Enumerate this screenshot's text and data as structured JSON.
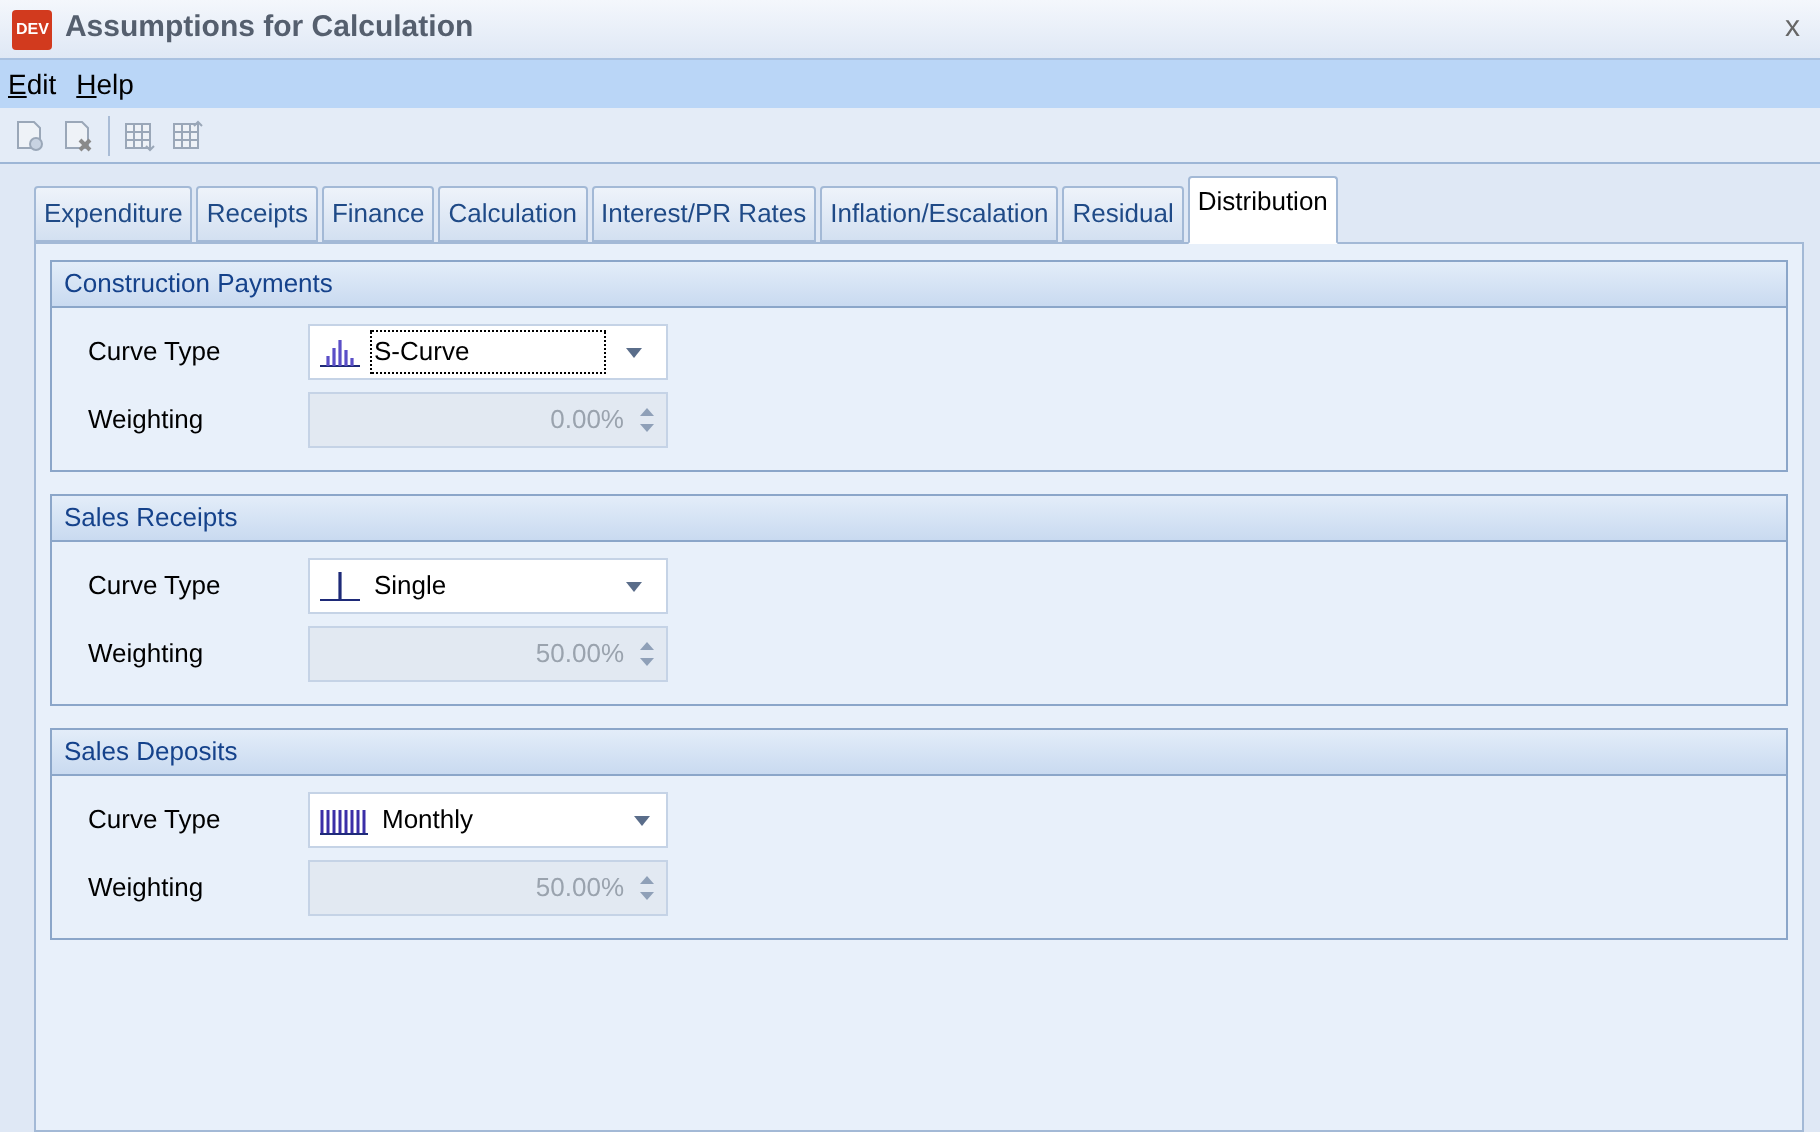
{
  "window": {
    "logo": "DEV",
    "title": "Assumptions for Calculation",
    "close": "x"
  },
  "menu": [
    "Edit",
    "Help"
  ],
  "toolbar": [
    {
      "kind": "page_add",
      "disabled": true
    },
    {
      "kind": "page_delete",
      "disabled": true
    },
    {
      "kind": "grid_down",
      "disabled": true
    },
    {
      "kind": "grid_up",
      "disabled": true
    }
  ],
  "tabs": [
    {
      "label": "Expenditure",
      "selected": false
    },
    {
      "label": "Receipts",
      "selected": false
    },
    {
      "label": "Finance",
      "selected": false
    },
    {
      "label": "Calculation",
      "selected": false
    },
    {
      "label": "Interest/PR Rates",
      "selected": false
    },
    {
      "label": "Inflation/Escalation",
      "selected": false
    },
    {
      "label": "Residual",
      "selected": false
    },
    {
      "label": "Distribution",
      "selected": true
    }
  ],
  "groups": [
    {
      "title": "Construction Payments",
      "curve_label": "Curve Type",
      "curve": {
        "kind": "s_curve",
        "value": "S-Curve",
        "focused": true
      },
      "weighting_label": "Weighting",
      "weighting": {
        "value": "0.00%",
        "disabled": true
      }
    },
    {
      "title": "Sales Receipts",
      "curve_label": "Curve Type",
      "curve": {
        "kind": "single",
        "value": "Single",
        "focused": false
      },
      "weighting_label": "Weighting",
      "weighting": {
        "value": "50.00%",
        "disabled": true
      }
    },
    {
      "title": "Sales Deposits",
      "curve_label": "Curve Type",
      "curve": {
        "kind": "monthly",
        "value": "Monthly",
        "focused": false
      },
      "weighting_label": "Weighting",
      "weighting": {
        "value": "50.00%",
        "disabled": true
      }
    }
  ]
}
